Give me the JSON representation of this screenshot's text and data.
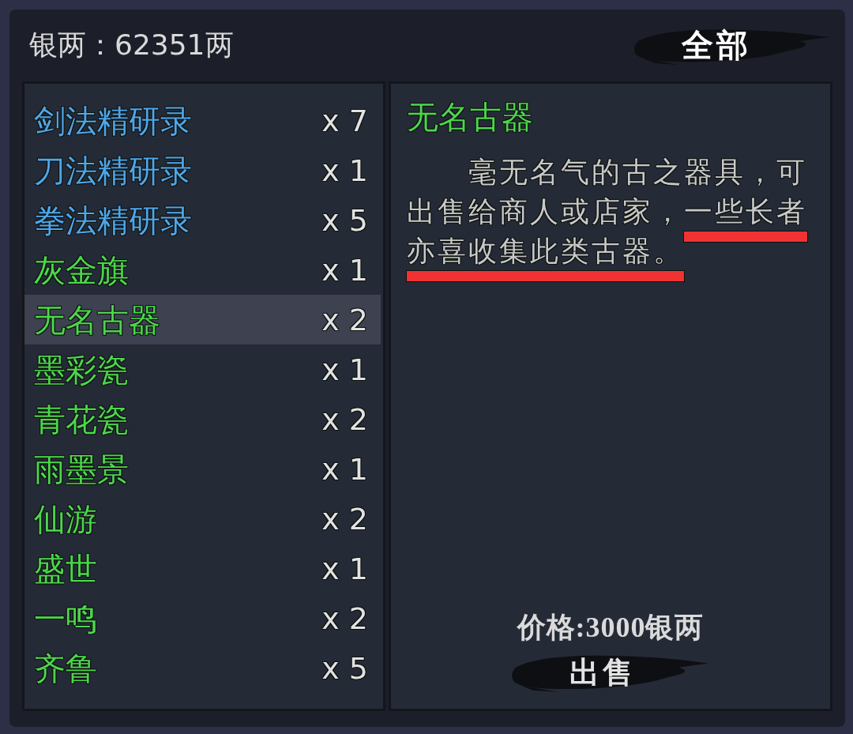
{
  "header": {
    "balance": "银两：62351两",
    "filter_button": "全部"
  },
  "items": [
    {
      "name": "剑法精研录",
      "count": "x 7",
      "color": "#4ea6ea",
      "selected": false
    },
    {
      "name": "刀法精研录",
      "count": "x 1",
      "color": "#4ea6ea",
      "selected": false
    },
    {
      "name": "拳法精研录",
      "count": "x 5",
      "color": "#4ea6ea",
      "selected": false
    },
    {
      "name": "灰金旗",
      "count": "x 1",
      "color": "#4cd64c",
      "selected": false
    },
    {
      "name": "无名古器",
      "count": "x 2",
      "color": "#4cd64c",
      "selected": true
    },
    {
      "name": "墨彩瓷",
      "count": "x 1",
      "color": "#4cd64c",
      "selected": false
    },
    {
      "name": "青花瓷",
      "count": "x 2",
      "color": "#4cd64c",
      "selected": false
    },
    {
      "name": "雨墨景",
      "count": "x 1",
      "color": "#4cd64c",
      "selected": false
    },
    {
      "name": "仙游",
      "count": "x 2",
      "color": "#4cd64c",
      "selected": false
    },
    {
      "name": "盛世",
      "count": "x 1",
      "color": "#4cd64c",
      "selected": false
    },
    {
      "name": "一鸣",
      "count": "x 2",
      "color": "#4cd64c",
      "selected": false
    },
    {
      "name": "齐鲁",
      "count": "x 5",
      "color": "#4cd64c",
      "selected": false
    }
  ],
  "detail": {
    "title": "无名古器",
    "description": [
      {
        "text": "毫无名气的古之器具，可出售给商人或店家，",
        "underlined": false
      },
      {
        "text": "一些长者亦喜收集此类古器。",
        "underlined": true
      }
    ],
    "price": "价格:3000银两",
    "sell_button": "出售"
  }
}
